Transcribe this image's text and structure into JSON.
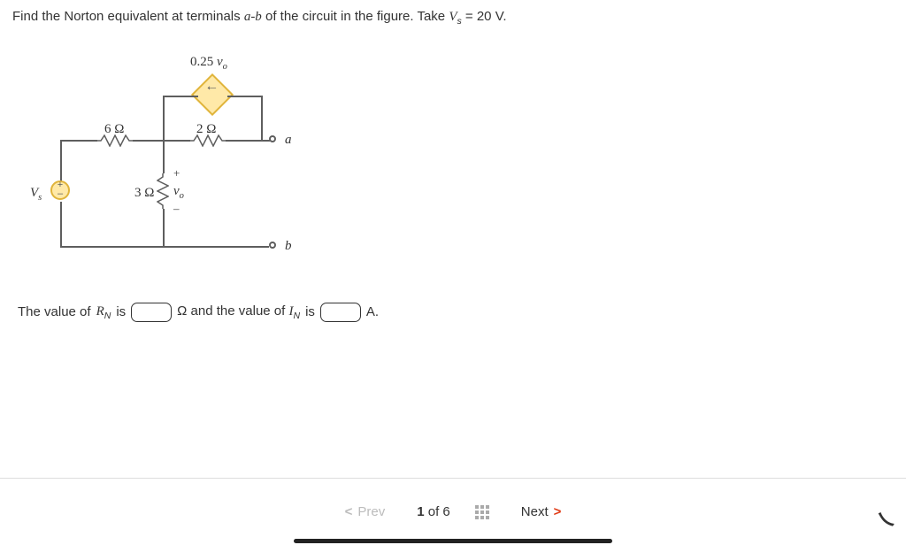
{
  "problem": {
    "lead": "Find the Norton equivalent at terminals ",
    "span_ab": "a-b",
    "mid": " of the circuit in the figure. Take ",
    "var": "V",
    "varsub": "s",
    "val": " = 20 V."
  },
  "circuit": {
    "dep_label_pre": "0.25 ",
    "dep_label_var": "v",
    "dep_label_sub": "o",
    "r6": "6 Ω",
    "r2": "2 Ω",
    "r3": "3 Ω",
    "term_a": "a",
    "term_b": "b",
    "vs_var": "V",
    "vs_sub": "s",
    "vo_plus": "+",
    "vo_var": "v",
    "vo_sub": "o",
    "vo_minus": "–",
    "src_top": "+",
    "src_bot": "–"
  },
  "answer": {
    "pre1": "The value of ",
    "rn_var": "R",
    "rn_sub": "N",
    "is1": " is",
    "unit1": "Ω and the value of ",
    "in_var": "I",
    "in_sub": "N",
    "is2": " is",
    "unit2": "A."
  },
  "nav": {
    "prev": "Prev",
    "next": "Next",
    "page_cur": "1",
    "page_of": "of",
    "page_tot": "6"
  }
}
